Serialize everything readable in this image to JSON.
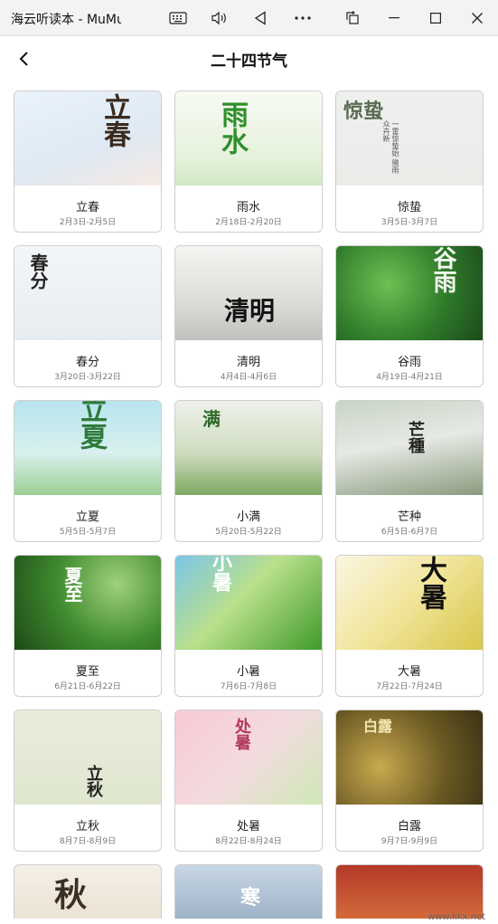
{
  "window": {
    "title": "海云听读本 - MuMu"
  },
  "header": {
    "title": "二十四节气"
  },
  "terms": [
    {
      "name": "立春",
      "dates": "2月3日-2月5日",
      "art": "立春",
      "sub": "",
      "bg": "linear-gradient(160deg,#eaf3fb 0%,#dfe9f3 60%,#f6e9e3 100%)"
    },
    {
      "name": "雨水",
      "dates": "2月18日-2月20日",
      "art": "雨水",
      "sub": "",
      "bg": "linear-gradient(180deg,#f7faf3 0%,#e6f2dc 70%,#cfe8c4 100%)"
    },
    {
      "name": "惊蛰",
      "dates": "3月5日-3月7日",
      "art": "惊蛰",
      "sub": "一雷惊蛰始 微雨众卉新",
      "bg": "linear-gradient(180deg,#eef0ee 0%,#e9ece8 100%)"
    },
    {
      "name": "春分",
      "dates": "3月20日-3月22日",
      "art": "春分",
      "sub": "",
      "bg": "linear-gradient(180deg,#f3f5f8 0%,#e8edf2 100%)"
    },
    {
      "name": "清明",
      "dates": "4月4日-4月6日",
      "art": "清明",
      "sub": "",
      "bg": "linear-gradient(180deg,#f4f4f2 0%,#dcdcd8 60%,#bfc2bf 100%)"
    },
    {
      "name": "谷雨",
      "dates": "4月19日-4月21日",
      "art": "谷雨",
      "sub": "",
      "bg": "radial-gradient(circle at 35% 40%,#6fbf52 0%,#2f7a2a 55%,#1c4a1c 100%)"
    },
    {
      "name": "立夏",
      "dates": "5月5日-5月7日",
      "art": "立夏",
      "sub": "",
      "bg": "linear-gradient(180deg,#b8e4ef 0%,#d8f0ee 55%,#9ccf93 100%)"
    },
    {
      "name": "小满",
      "dates": "5月20日-5月22日",
      "art": "满",
      "sub": "",
      "bg": "linear-gradient(180deg,#eef1ea 0%,#cfdcc0 55%,#7fa861 100%)"
    },
    {
      "name": "芒种",
      "dates": "6月5日-6月7日",
      "art": "芒種",
      "sub": "",
      "bg": "linear-gradient(170deg,#c9d4c6 0%,#e6e9e4 45%,#8a9b7e 100%)"
    },
    {
      "name": "夏至",
      "dates": "6月21日-6月22日",
      "art": "夏至",
      "sub": "",
      "bg": "radial-gradient(circle at 70% 30%,#9fd17a 0%,#3f8a2f 50%,#1d4a17 100%)"
    },
    {
      "name": "小暑",
      "dates": "7月6日-7月8日",
      "art": "小暑",
      "sub": "",
      "bg": "linear-gradient(135deg,#7cc5e8 0%,#b9e08a 45%,#3f9a2a 100%)"
    },
    {
      "name": "大暑",
      "dates": "7月22日-7月24日",
      "art": "大暑",
      "sub": "",
      "bg": "linear-gradient(135deg,#fbf6e2 0%,#f1e59a 50%,#d8c64a 100%)"
    },
    {
      "name": "立秋",
      "dates": "8月7日-8月9日",
      "art": "立秋",
      "sub": "",
      "bg": "linear-gradient(180deg,#e9ecdc 0%,#dfe6cf 100%)"
    },
    {
      "name": "处暑",
      "dates": "8月22日-8月24日",
      "art": "处暑",
      "sub": "",
      "bg": "linear-gradient(135deg,#f7c9d3 0%,#f4dbe0 50%,#cfe8b6 100%)"
    },
    {
      "name": "白露",
      "dates": "9月7日-9月9日",
      "art": "白露",
      "sub": "",
      "bg": "radial-gradient(circle at 30% 60%,#c9a94f 0%,#6b5a23 55%,#3a3214 100%)"
    }
  ],
  "partial_row": [
    {
      "art": "秋",
      "bg": "linear-gradient(180deg,#f4efe6 0%,#ebe3d4 100%)"
    },
    {
      "art": "寒",
      "bg": "linear-gradient(180deg,#c8d7e6 0%,#9eb2c6 100%)"
    },
    {
      "art": "",
      "bg": "linear-gradient(180deg,#b33a2a 0%,#d36a3a 100%)"
    }
  ],
  "watermark": {
    "text": "www.kkx.net"
  }
}
